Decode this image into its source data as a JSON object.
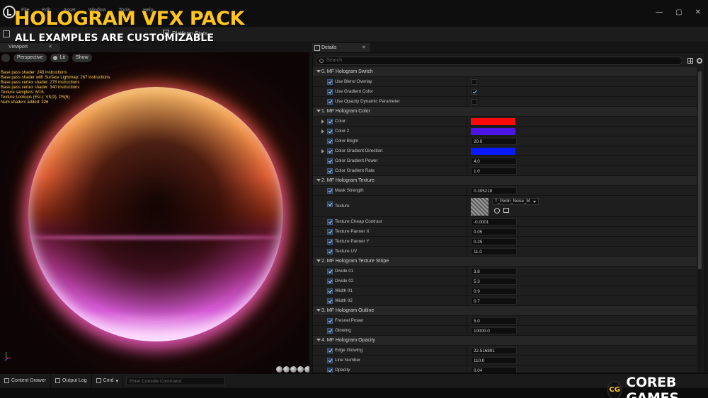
{
  "menu": [
    "File",
    "Edit",
    "Asset",
    "Window",
    "Tools",
    "Help"
  ],
  "window_controls": [
    "—",
    "▢",
    "✕"
  ],
  "toolbar": {
    "platform_stats": "Platform Stats"
  },
  "overlay": {
    "title": "HOLOGRAM VFX PACK",
    "subtitle": "ALL EXAMPLES ARE CUSTOMIZABLE"
  },
  "viewport": {
    "tab_label": "Viewport",
    "buttons": {
      "perspective": "Perspective",
      "lit": "Lit",
      "show": "Show"
    },
    "stats": [
      "Base pass shader: 243 instructions",
      "Base pass shader with Surface Lightmap: 267 instructions",
      "Base pass vertex shader: 278 instructions",
      "Base pass vertex shader: 340 instructions",
      "Texture samplers: 6/16",
      "Texture Lookups (Est.): VS(3), PS(6)",
      "Num shaders added: 226"
    ]
  },
  "bottombar": {
    "content_drawer": "Content Drawer",
    "output_log": "Output Log",
    "cmd": "Cmd",
    "console_placeholder": "Enter Console Command"
  },
  "details": {
    "tab_label": "Details",
    "search_placeholder": "Search",
    "sections": [
      {
        "label": "0. MF Hologram Switch",
        "rows": [
          {
            "label": "Use Blend Overlay",
            "kind": "bool",
            "value": false
          },
          {
            "label": "Use Gradient Color",
            "kind": "bool",
            "value": true
          },
          {
            "label": "Use Opacity Dynamic Parameter",
            "kind": "bool",
            "value": false
          }
        ]
      },
      {
        "label": "1. MF Hologram Color",
        "rows": [
          {
            "label": "Color",
            "kind": "color",
            "value": "#ff0a0a",
            "expand": true
          },
          {
            "label": "Color 2",
            "kind": "color",
            "value": "#4b16e6",
            "expand": true
          },
          {
            "label": "Color Bright",
            "kind": "number",
            "value": "20.0"
          },
          {
            "label": "Color Gradient Direction",
            "kind": "color",
            "value": "#0a1aff",
            "expand": true
          },
          {
            "label": "Color Gradient Power",
            "kind": "number",
            "value": "4.0"
          },
          {
            "label": "Color Gradient Rate",
            "kind": "number",
            "value": "1.0"
          }
        ]
      },
      {
        "label": "2. MF Hologram Texture",
        "rows": [
          {
            "label": "Mask Strength",
            "kind": "number",
            "value": "0.305218"
          },
          {
            "label": "Texture",
            "kind": "texture",
            "value": "T_Perlin_Noise_M"
          },
          {
            "label": "Texture Cheap Contrast",
            "kind": "number",
            "value": "-0.0001"
          },
          {
            "label": "Texture Panner X",
            "kind": "number",
            "value": "0.05"
          },
          {
            "label": "Texture Panner Y",
            "kind": "number",
            "value": "0.25"
          },
          {
            "label": "Texture UV",
            "kind": "number",
            "value": "11.0"
          }
        ]
      },
      {
        "label": "2. MF Hologram Texture Stripe",
        "rows": [
          {
            "label": "Divide 01",
            "kind": "number",
            "value": "3.8"
          },
          {
            "label": "Divide 02",
            "kind": "number",
            "value": "5.3"
          },
          {
            "label": "Width 01",
            "kind": "number",
            "value": "0.9"
          },
          {
            "label": "Width 02",
            "kind": "number",
            "value": "0.7"
          }
        ]
      },
      {
        "label": "3. MF Hologram Outline",
        "rows": [
          {
            "label": "Fresnel Power",
            "kind": "number",
            "value": "5.0"
          },
          {
            "label": "Glowing",
            "kind": "number",
            "value": "10000.0"
          }
        ]
      },
      {
        "label": "4. MF Hologram Opacity",
        "rows": [
          {
            "label": "Edge Glowing",
            "kind": "number",
            "value": "22.516891"
          },
          {
            "label": "Line Number",
            "kind": "number",
            "value": "110.0"
          },
          {
            "label": "Opacity",
            "kind": "number",
            "value": "0.04"
          }
        ]
      }
    ]
  },
  "brand": {
    "logo": "CG",
    "name": "COREB GAMES"
  }
}
